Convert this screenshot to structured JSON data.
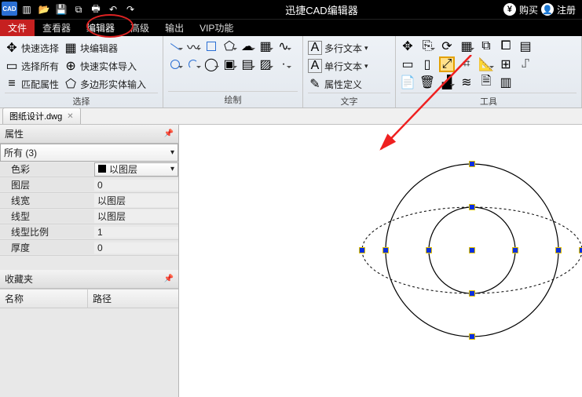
{
  "app_title": "迅捷CAD编辑器",
  "titlebar": {
    "buy": "购买",
    "register": "注册",
    "cad_logo": "CAD"
  },
  "menu": {
    "file": "文件",
    "viewer": "查看器",
    "editor": "编辑器",
    "advanced": "高级",
    "output": "输出",
    "vip": "VIP功能"
  },
  "ribbon": {
    "select": {
      "label": "选择",
      "quick": "快速选择",
      "block": "块编辑器",
      "all": "选择所有",
      "import": "快速实体导入",
      "match": "匹配属性",
      "poly": "多边形实体输入"
    },
    "draw": {
      "label": "绘制"
    },
    "text": {
      "label": "文字",
      "multi": "多行文本",
      "single": "单行文本",
      "attr": "属性定义"
    },
    "tools": {
      "label": "工具"
    }
  },
  "doc": {
    "name": "图纸设计.dwg"
  },
  "panel": {
    "props_title": "属性",
    "fav_title": "收藏夹",
    "filter": "所有 (3)",
    "rows": {
      "color": {
        "k": "色彩",
        "v": "以图层"
      },
      "layer": {
        "k": "图层",
        "v": "0"
      },
      "lw": {
        "k": "线宽",
        "v": "以图层"
      },
      "lt": {
        "k": "线型",
        "v": "以图层"
      },
      "lts": {
        "k": "线型比例",
        "v": "1"
      },
      "thk": {
        "k": "厚度",
        "v": "0"
      }
    },
    "fav_cols": {
      "name": "名称",
      "path": "路径"
    }
  }
}
